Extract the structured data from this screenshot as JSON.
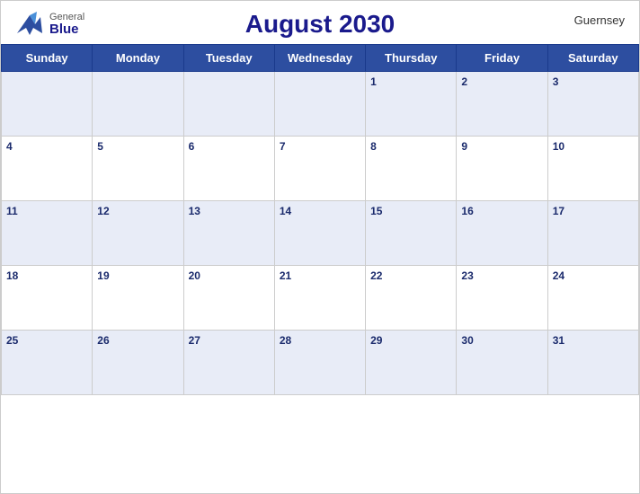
{
  "header": {
    "title": "August 2030",
    "brand_general": "General",
    "brand_blue": "Blue",
    "region": "Guernsey"
  },
  "weekdays": [
    "Sunday",
    "Monday",
    "Tuesday",
    "Wednesday",
    "Thursday",
    "Friday",
    "Saturday"
  ],
  "weeks": [
    [
      {
        "day": "",
        "empty": true
      },
      {
        "day": "",
        "empty": true
      },
      {
        "day": "",
        "empty": true
      },
      {
        "day": "",
        "empty": true
      },
      {
        "day": "1"
      },
      {
        "day": "2"
      },
      {
        "day": "3"
      }
    ],
    [
      {
        "day": "4"
      },
      {
        "day": "5"
      },
      {
        "day": "6"
      },
      {
        "day": "7"
      },
      {
        "day": "8"
      },
      {
        "day": "9"
      },
      {
        "day": "10"
      }
    ],
    [
      {
        "day": "11"
      },
      {
        "day": "12"
      },
      {
        "day": "13"
      },
      {
        "day": "14"
      },
      {
        "day": "15"
      },
      {
        "day": "16"
      },
      {
        "day": "17"
      }
    ],
    [
      {
        "day": "18"
      },
      {
        "day": "19"
      },
      {
        "day": "20"
      },
      {
        "day": "21"
      },
      {
        "day": "22"
      },
      {
        "day": "23"
      },
      {
        "day": "24"
      }
    ],
    [
      {
        "day": "25"
      },
      {
        "day": "26"
      },
      {
        "day": "27"
      },
      {
        "day": "28"
      },
      {
        "day": "29"
      },
      {
        "day": "30"
      },
      {
        "day": "31"
      }
    ]
  ]
}
